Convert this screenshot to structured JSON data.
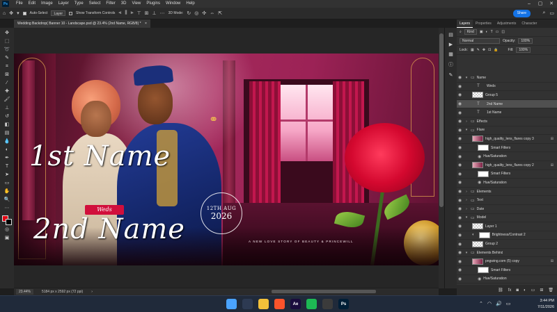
{
  "menubar": {
    "app_icon": "Ps",
    "items": [
      "File",
      "Edit",
      "Image",
      "Layer",
      "Type",
      "Select",
      "Filter",
      "3D",
      "View",
      "Plugins",
      "Window",
      "Help"
    ],
    "window_controls": [
      "minimize-icon",
      "maximize-icon",
      "close-icon"
    ]
  },
  "options": {
    "auto_select_label": "Auto-Select",
    "auto_select_checked": true,
    "auto_select_target": "Layer",
    "show_transform_label": "Show Transform Controls",
    "show_transform_checked": false,
    "mode_3d_label": "3D Mode:",
    "share_label": "Share"
  },
  "document": {
    "tab_title": "Wedding Backdrop( Banner 10 - Landscape.psd @ 23.4% (2nd Name, RGB/8) *",
    "close_glyph": "×"
  },
  "artwork": {
    "name1": "1st Name",
    "weds": "Weds",
    "name2": "2nd Name",
    "date_line1": "12TH AUG",
    "date_line2": "2026",
    "tagline": "A NEW LOVE STORY OF BEAUTY & PRINCEWILL"
  },
  "statusbar": {
    "zoom": "23.44%",
    "doc_info": "5184 px x 2592 px (72 ppi)"
  },
  "layers_panel": {
    "tabs": [
      "Layers",
      "Properties",
      "Adjustments",
      "Character"
    ],
    "active_tab": "Layers",
    "filter_kind": "Kind",
    "blend_mode": "Normal",
    "opacity_label": "Opacity:",
    "opacity_value": "100%",
    "lock_label": "Lock:",
    "fill_label": "Fill:",
    "fill_value": "100%",
    "layers": [
      {
        "name": "Name",
        "type": "group",
        "indent": 0,
        "expanded": true
      },
      {
        "name": "Weds",
        "type": "text",
        "indent": 1
      },
      {
        "name": "Group 5",
        "type": "pixel",
        "indent": 1
      },
      {
        "name": "2nd Name",
        "type": "text",
        "indent": 1,
        "selected": true
      },
      {
        "name": "1st Name",
        "type": "text",
        "indent": 1
      },
      {
        "name": "Effects",
        "type": "group",
        "indent": 0,
        "expanded": false
      },
      {
        "name": "Flare",
        "type": "group",
        "indent": 0,
        "expanded": true
      },
      {
        "name": "high_quality_lens_flares copy 3",
        "type": "smart",
        "indent": 1,
        "fx": true
      },
      {
        "name": "Smart Filters",
        "type": "filtermask",
        "indent": 2
      },
      {
        "name": "Hue/Saturation",
        "type": "filter",
        "indent": 2
      },
      {
        "name": "high_quality_lens_flares copy 2",
        "type": "smart",
        "indent": 1,
        "fx": true
      },
      {
        "name": "Smart Filters",
        "type": "filtermask",
        "indent": 2
      },
      {
        "name": "Hue/Saturation",
        "type": "filter",
        "indent": 2
      },
      {
        "name": "Elements",
        "type": "group",
        "indent": 0,
        "expanded": false
      },
      {
        "name": "Text",
        "type": "group",
        "indent": 0,
        "expanded": false
      },
      {
        "name": "Date",
        "type": "group",
        "indent": 0,
        "expanded": false
      },
      {
        "name": "Model",
        "type": "group",
        "indent": 0,
        "expanded": true
      },
      {
        "name": "Layer 1",
        "type": "pixel",
        "indent": 1
      },
      {
        "name": "Brightness/Contrast 2",
        "type": "adjustment",
        "indent": 1
      },
      {
        "name": "Group 2",
        "type": "pixel",
        "indent": 1
      },
      {
        "name": "Elements Behind",
        "type": "group",
        "indent": 0,
        "expanded": true
      },
      {
        "name": "pngwing.com (5) copy",
        "type": "smart",
        "indent": 1,
        "fx": true
      },
      {
        "name": "Smart Filters",
        "type": "filtermask",
        "indent": 2
      },
      {
        "name": "Hue/Saturation",
        "type": "filter",
        "indent": 2
      },
      {
        "name": "Motion Blur",
        "type": "filter",
        "indent": 2
      },
      {
        "name": "Hue/Saturation",
        "type": "filter",
        "indent": 2
      },
      {
        "name": "Cloud - Copy",
        "type": "pixel",
        "indent": 1
      }
    ],
    "footer_icons": [
      "link-icon",
      "fx-icon",
      "mask-icon",
      "adjustment-icon",
      "folder-icon",
      "new-layer-icon",
      "trash-icon"
    ]
  },
  "taskbar": {
    "apps": [
      {
        "name": "windows-start-icon",
        "label": "",
        "color": "#4aa3ff"
      },
      {
        "name": "search-icon",
        "label": "",
        "color": "#2d3a52"
      },
      {
        "name": "file-explorer-icon",
        "label": "",
        "color": "#f3c13a"
      },
      {
        "name": "brave-browser-icon",
        "label": "",
        "color": "#fb542b"
      },
      {
        "name": "after-effects-icon",
        "label": "Ae",
        "color": "#1a0c3d"
      },
      {
        "name": "spotify-icon",
        "label": "",
        "color": "#1db954"
      },
      {
        "name": "capture-icon",
        "label": "",
        "color": "#3b3b3b"
      },
      {
        "name": "photoshop-icon",
        "label": "Ps",
        "color": "#001e36"
      }
    ],
    "time": "3:44 PM",
    "date": "7/11/2026"
  },
  "colors": {
    "accent": "#1473e6",
    "foreground_swatch": "#e30613",
    "background_swatch": "#000000"
  }
}
